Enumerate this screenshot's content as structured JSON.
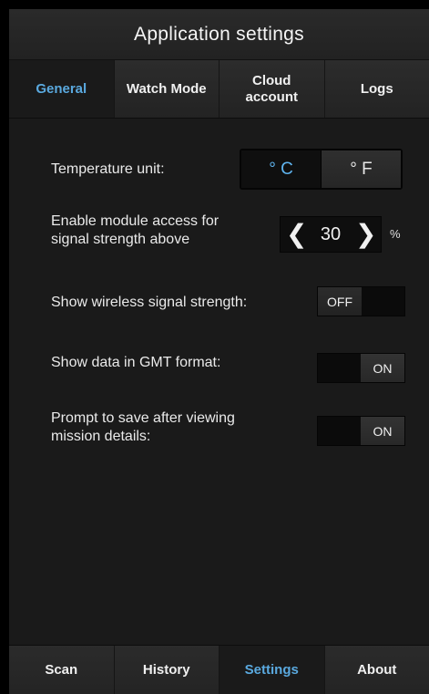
{
  "title": "Application settings",
  "tabs": [
    {
      "label": "General",
      "active": true
    },
    {
      "label": "Watch Mode",
      "active": false
    },
    {
      "label": "Cloud\naccount",
      "active": false
    },
    {
      "label": "Logs",
      "active": false
    }
  ],
  "settings": {
    "temperature": {
      "label": "Temperature unit:",
      "options": [
        "° C",
        "° F"
      ],
      "selected": "° C"
    },
    "signal": {
      "label_line1": "Enable module access for",
      "label_line2": "signal strength above",
      "value": "30",
      "unit": "%",
      "decrement_glyph": "❮",
      "increment_glyph": "❯"
    },
    "wireless": {
      "label": "Show wireless signal strength:",
      "state": "OFF"
    },
    "gmt": {
      "label": "Show data in GMT format:",
      "state": "ON"
    },
    "prompt": {
      "label_line1": "Prompt to save after viewing",
      "label_line2": "mission details:",
      "state": "ON"
    }
  },
  "bottom_nav": [
    {
      "label": "Scan",
      "active": false
    },
    {
      "label": "History",
      "active": false
    },
    {
      "label": "Settings",
      "active": true
    },
    {
      "label": "About",
      "active": false
    }
  ],
  "colors": {
    "accent": "#5aa9df",
    "background": "#1a1a1a"
  }
}
